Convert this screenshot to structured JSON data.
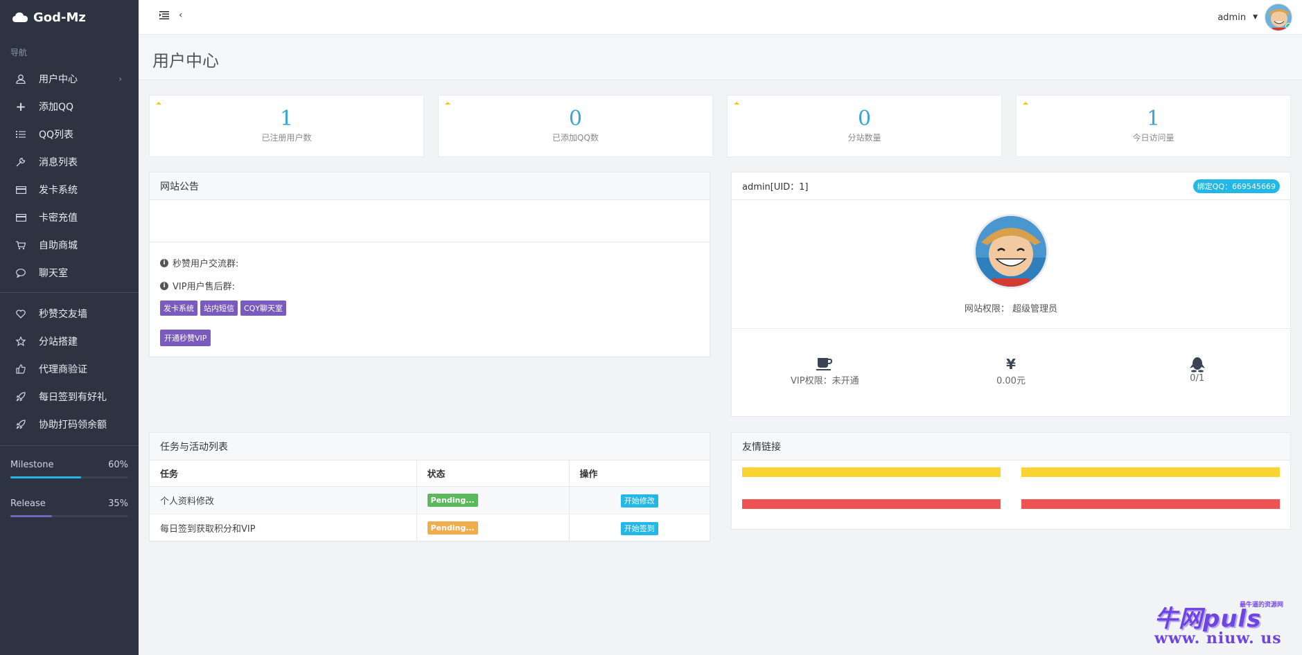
{
  "brand": {
    "name": "God-Mz",
    "icon": "cloud-icon"
  },
  "sidebar": {
    "heading": "导航",
    "items": [
      {
        "label": "用户中心",
        "icon": "user-icon",
        "has_caret": true
      },
      {
        "label": "添加QQ",
        "icon": "plus-icon"
      },
      {
        "label": "QQ列表",
        "icon": "list-icon"
      },
      {
        "label": "消息列表",
        "icon": "wrench-icon"
      },
      {
        "label": "发卡系统",
        "icon": "card-icon"
      },
      {
        "label": "卡密充值",
        "icon": "card-icon"
      },
      {
        "label": "自助商城",
        "icon": "cart-icon"
      },
      {
        "label": "聊天室",
        "icon": "chat-icon"
      }
    ],
    "items2": [
      {
        "label": "秒赞交友墙",
        "icon": "heart-icon"
      },
      {
        "label": "分站搭建",
        "icon": "star-icon"
      },
      {
        "label": "代理商验证",
        "icon": "thumb-icon"
      },
      {
        "label": "每日签到有好礼",
        "icon": "rocket-icon"
      },
      {
        "label": "协助打码领余额",
        "icon": "rocket-icon"
      }
    ],
    "progress": [
      {
        "label": "Milestone",
        "percent_text": "60%",
        "value": 0.6,
        "color": "#23b7e5"
      },
      {
        "label": "Release",
        "percent_text": "35%",
        "value": 0.35,
        "color": "#7266ba"
      }
    ]
  },
  "topbar": {
    "user": "admin"
  },
  "page": {
    "title": "用户中心"
  },
  "stats": [
    {
      "value": "1",
      "label": "已注册用户数"
    },
    {
      "value": "0",
      "label": "已添加QQ数"
    },
    {
      "value": "0",
      "label": "分站数量"
    },
    {
      "value": "1",
      "label": "今日访问量"
    }
  ],
  "notice": {
    "title": "网站公告",
    "line1": "秒赞用户交流群:",
    "line2": "VIP用户售后群:",
    "tags": [
      "发卡系统",
      "站内短信",
      "CQY聊天室"
    ],
    "vip_button": "开通秒赞VIP"
  },
  "profile": {
    "user_line": "admin[UID：1]",
    "qq_badge": "绑定QQ：669545669",
    "permission": "网站权限： 超级管理员",
    "stats": [
      {
        "icon": "coffee-icon",
        "text": "VIP权限：未开通"
      },
      {
        "icon": "yen-icon",
        "glyph": "¥",
        "text": "0.00元"
      },
      {
        "icon": "qq-penguin-icon",
        "text": "0/1"
      }
    ]
  },
  "tasks": {
    "title": "任务与活动列表",
    "headers": [
      "任务",
      "状态",
      "操作"
    ],
    "rows": [
      {
        "task": "个人资料修改",
        "status": "Pending...",
        "status_color": "#5cb85c",
        "action": "开始修改"
      },
      {
        "task": "每日签到获取积分和VIP",
        "status": "Pending...",
        "status_color": "#f0ad4e",
        "action": "开始签到"
      }
    ]
  },
  "links": {
    "title": "友情链接",
    "rows": [
      {
        "color": "#f9d432"
      },
      {
        "color": "#ee5253"
      }
    ]
  },
  "watermark": {
    "title": "牛网puls",
    "tagline": "最牛逼的资源网",
    "url": "www. niuw. us"
  }
}
